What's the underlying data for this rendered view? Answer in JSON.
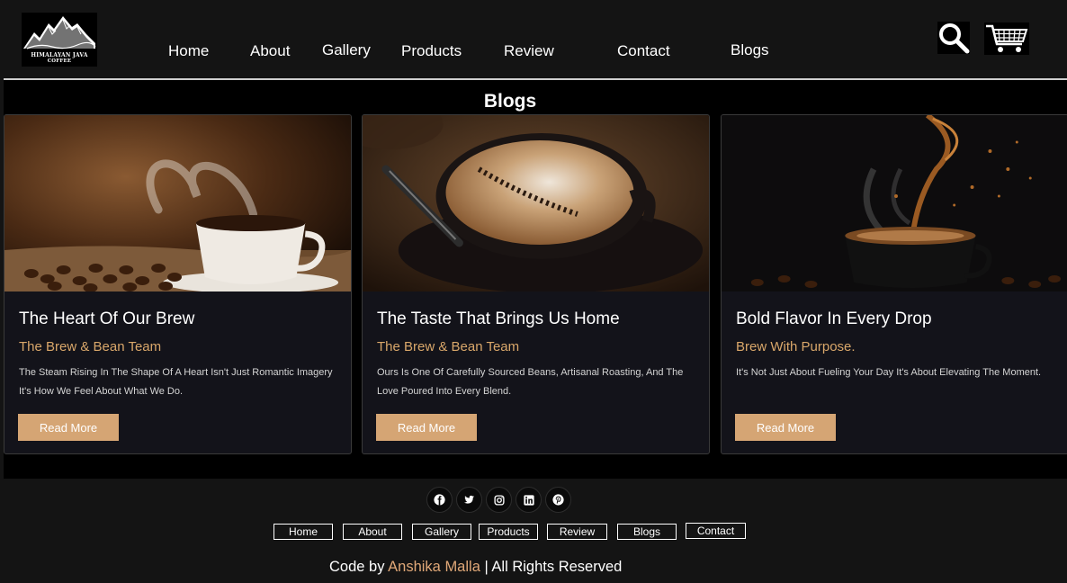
{
  "brand": {
    "name_line1": "HIMALAYAN JAVA",
    "name_line2": "COFFEE"
  },
  "nav": {
    "items": [
      "Home",
      "About",
      "Gallery",
      "Products",
      "Review",
      "Contact",
      "Blogs"
    ]
  },
  "header_icons": [
    "search-icon",
    "cart-icon"
  ],
  "blogs": {
    "title": "Blogs",
    "cards": [
      {
        "title": "The Heart Of Our Brew",
        "author": "The Brew & Bean Team",
        "text": "The Steam Rising In The Shape Of A Heart Isn't Just Romantic Imagery It's How We Feel About What We Do.",
        "button": "Read More"
      },
      {
        "title": "The Taste That Brings Us Home",
        "author": "The Brew & Bean Team",
        "text": "Ours Is One Of Carefully Sourced Beans, Artisanal Roasting, And The Love Poured Into Every Blend.",
        "button": "Read More"
      },
      {
        "title": "Bold Flavor In Every Drop",
        "author": "Brew With Purpose.",
        "text": "It's Not Just About Fueling Your Day It's About Elevating The Moment.",
        "button": "Read More"
      }
    ]
  },
  "footer": {
    "social_icons": [
      "facebook-icon",
      "twitter-icon",
      "instagram-icon",
      "linkedin-icon",
      "pinterest-icon"
    ],
    "links": [
      "Home",
      "About",
      "Gallery",
      "Products",
      "Review",
      "Blogs",
      "Contact"
    ],
    "credit_prefix": "Code by",
    "credit_name": "Anshika Malla",
    "credit_suffix": "| All Rights Reserved"
  },
  "colors": {
    "background": "#141414",
    "card_background": "#13131a",
    "accent": "#d5a574",
    "author_text": "#d9a76a"
  }
}
